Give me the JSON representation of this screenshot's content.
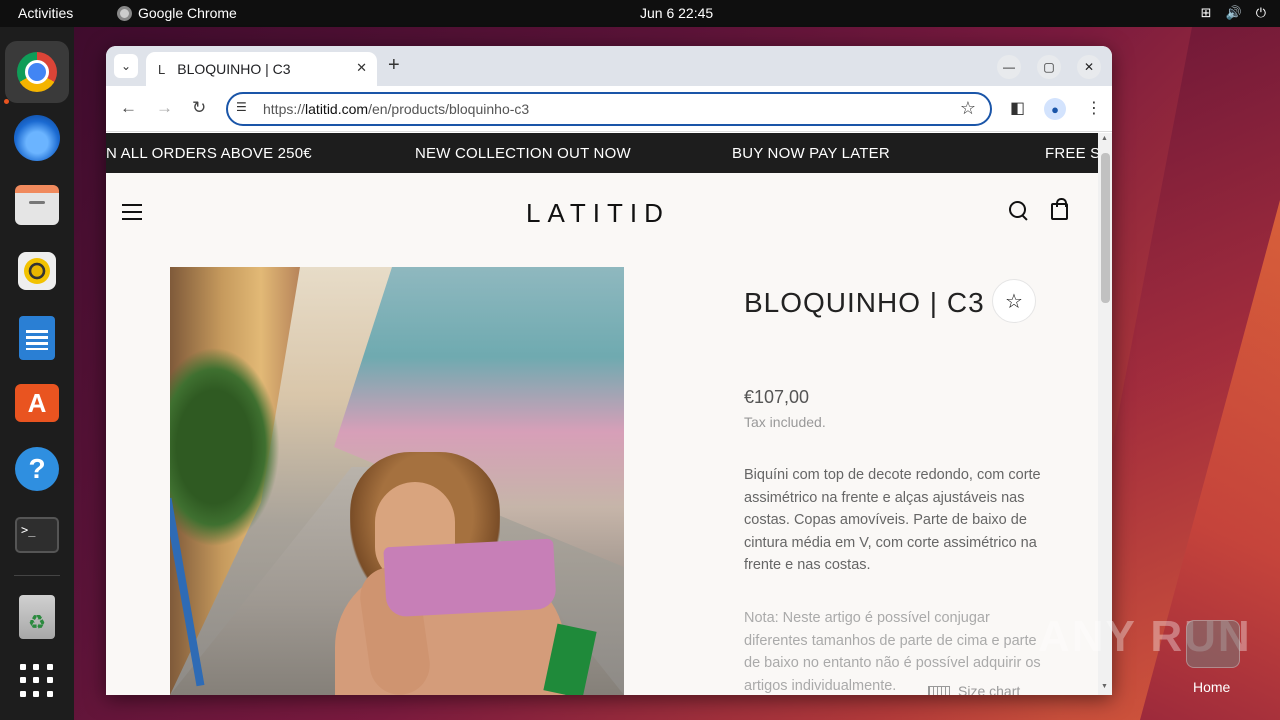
{
  "topbar": {
    "activities": "Activities",
    "app_name": "Google Chrome",
    "clock": "Jun 6  22:45"
  },
  "dock": {
    "items": [
      "chrome-icon",
      "thunderbird-icon",
      "files-icon",
      "rhythmbox-icon",
      "writer-icon",
      "app-center-icon",
      "help-icon",
      "terminal-icon",
      "trash-icon",
      "show-apps-icon"
    ]
  },
  "browser": {
    "tab_title": "BLOQUINHO | C3",
    "tab_favicon": "L",
    "url_prefix": "https://",
    "url_host": "latitid.com",
    "url_path": "/en/products/bloquinho-c3"
  },
  "site": {
    "marquee": [
      "N ALL ORDERS ABOVE 250€",
      "NEW COLLECTION OUT NOW",
      "BUY NOW PAY LATER",
      "FREE SH"
    ],
    "logo": "LATITID"
  },
  "product": {
    "title": "BLOQUINHO | C3",
    "price": "€107,00",
    "tax": "Tax included.",
    "description": "Biquíni com top de decote redondo, com corte assimétrico na frente e alças ajustáveis nas costas. Copas amovíveis. Parte de baixo de cintura média em V, com corte assimétrico na frente e nas costas.",
    "note": "Nota: Neste artigo é possível conjugar diferentes tamanhos de parte de cima e parte de baixo no entanto não é possível adquirir os artigos individualmente.",
    "size_chart": "Size chart"
  },
  "desktop": {
    "watermark": "ANY RUN",
    "home_label": "Home"
  }
}
